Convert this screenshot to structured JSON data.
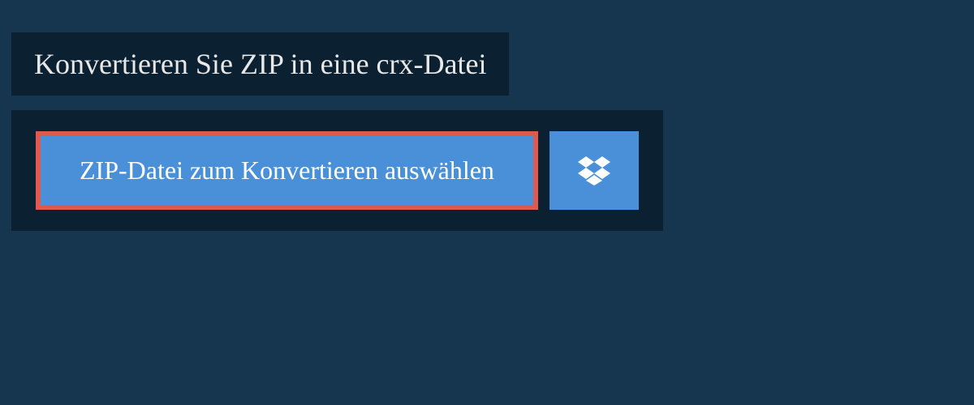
{
  "header": {
    "title": "Konvertieren Sie ZIP in eine crx-Datei"
  },
  "buttons": {
    "select_file_label": "ZIP-Datei zum Konvertieren auswählen"
  },
  "colors": {
    "page_bg": "#16364f",
    "panel_bg": "#0b2030",
    "button_bg": "#4a90d9",
    "button_border": "#de5a50",
    "text_light": "#e8e8e8"
  }
}
